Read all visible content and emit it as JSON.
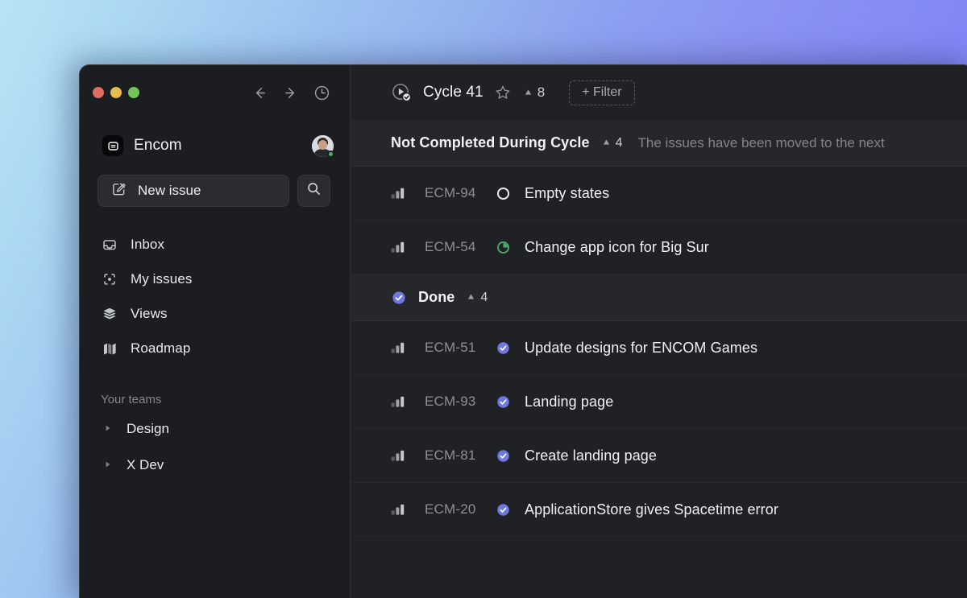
{
  "desktop": {
    "gradient_from": "#b6e4f5",
    "gradient_to": "#787af9"
  },
  "window": {
    "titlebar": {
      "traffic_lights": [
        {
          "name": "close",
          "color": "#e06c62"
        },
        {
          "name": "minimize",
          "color": "#e7bc52"
        },
        {
          "name": "maximize",
          "color": "#74c25a"
        }
      ],
      "nav_icons": [
        "arrow-left-icon",
        "arrow-right-icon",
        "history-clock-icon"
      ]
    }
  },
  "sidebar": {
    "workspace": {
      "logo_icon": "encom-logo-icon",
      "name": "Encom",
      "avatar": {
        "name": "avatar",
        "status": "online",
        "status_color": "#4caf6d"
      }
    },
    "new_issue": {
      "label": "New issue",
      "icon": "pencil-square-icon"
    },
    "search": {
      "icon": "search-icon"
    },
    "items": [
      {
        "label": "Inbox",
        "icon": "inbox-icon"
      },
      {
        "label": "My issues",
        "icon": "my-issues-target-icon"
      },
      {
        "label": "Views",
        "icon": "layers-icon"
      },
      {
        "label": "Roadmap",
        "icon": "roadmap-map-icon"
      }
    ],
    "teams_section_title": "Your teams",
    "teams": [
      {
        "label": "Design",
        "icon": "chevron-right-icon"
      },
      {
        "label": "X Dev",
        "icon": "chevron-right-icon"
      }
    ]
  },
  "main": {
    "header": {
      "cycle_icon": "cycle-completed-icon",
      "title": "Cycle 41",
      "star_icon": "star-outline-icon",
      "count_icon": "triangle-up-icon",
      "count": "8",
      "filter_label": "+ Filter"
    },
    "groups": [
      {
        "title": "Not Completed During Cycle",
        "count_icon": "triangle-up-icon",
        "count": "4",
        "description": "The issues have been moved to the next",
        "state_icon": null,
        "issues": [
          {
            "priority_icon": "priority-bars-icon",
            "id": "ECM-94",
            "state_icon": "status-todo-icon",
            "state": "Todo",
            "state_color": "#e8eaed",
            "title": "Empty states"
          },
          {
            "priority_icon": "priority-bars-icon",
            "id": "ECM-54",
            "state_icon": "status-in-progress-icon",
            "state": "In Progress",
            "state_color": "#4caf6d",
            "title": "Change app icon for Big Sur"
          }
        ]
      },
      {
        "title": "Done",
        "count_icon": "triangle-up-icon",
        "count": "4",
        "description": "",
        "state_icon": "status-done-icon",
        "state_color": "#6e79e0",
        "issues": [
          {
            "priority_icon": "priority-bars-icon",
            "id": "ECM-51",
            "state_icon": "status-done-icon",
            "state": "Done",
            "state_color": "#6e79e0",
            "title": "Update designs for ENCOM Games"
          },
          {
            "priority_icon": "priority-bars-icon",
            "id": "ECM-93",
            "state_icon": "status-done-icon",
            "state": "Done",
            "state_color": "#6e79e0",
            "title": "Landing page"
          },
          {
            "priority_icon": "priority-bars-icon",
            "id": "ECM-81",
            "state_icon": "status-done-icon",
            "state": "Done",
            "state_color": "#6e79e0",
            "title": "Create landing page"
          },
          {
            "priority_icon": "priority-bars-icon",
            "id": "ECM-20",
            "state_icon": "status-done-icon",
            "state": "Done",
            "state_color": "#6e79e0",
            "title": "ApplicationStore gives Spacetime error"
          }
        ]
      }
    ]
  }
}
